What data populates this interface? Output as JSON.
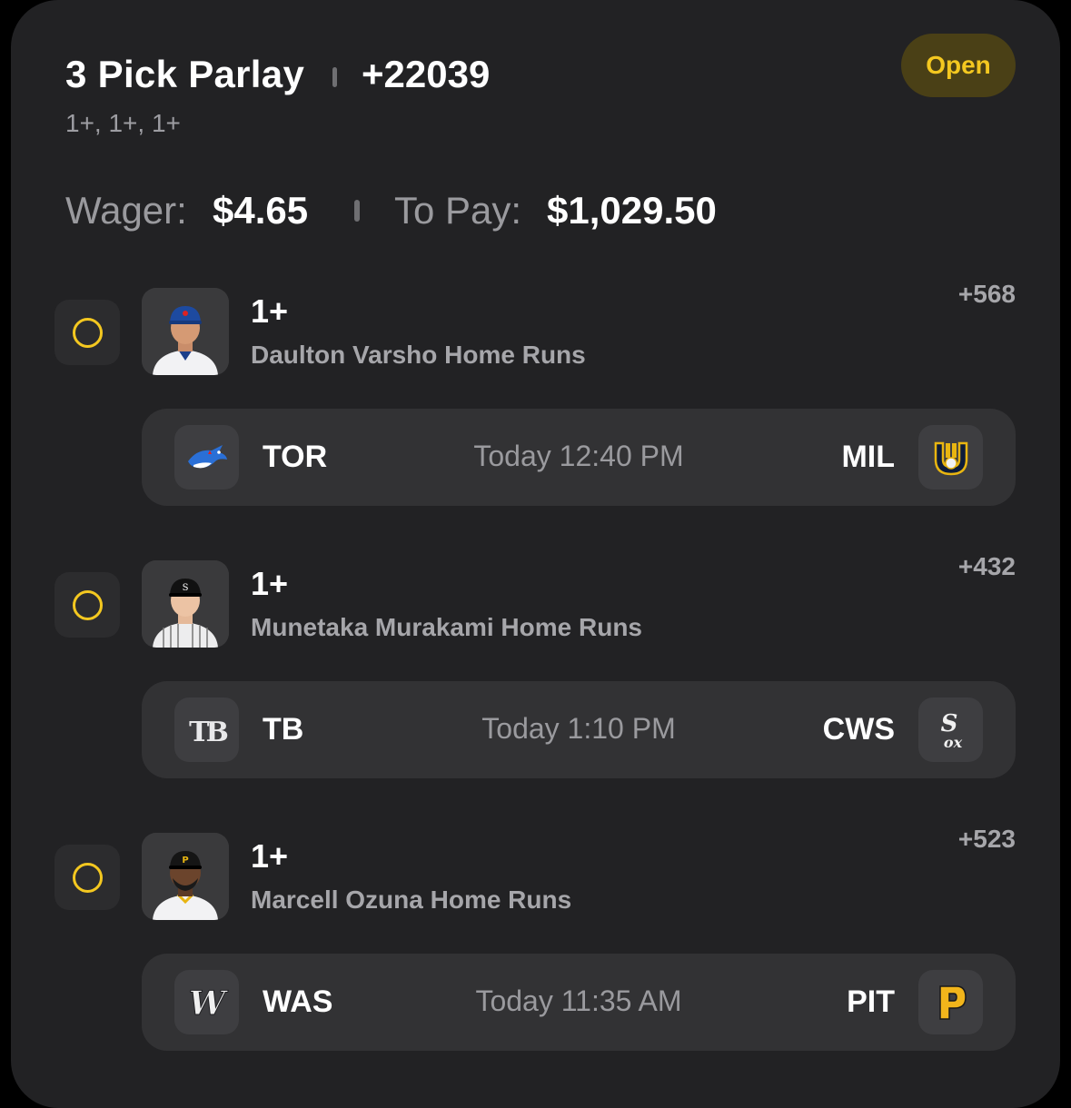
{
  "header": {
    "title": "3 Pick Parlay",
    "odds": "+22039",
    "subtitle": "1+, 1+, 1+",
    "status": "Open"
  },
  "wager": {
    "wager_label": "Wager:",
    "wager_value": "$4.65",
    "to_pay_label": "To Pay:",
    "to_pay_value": "$1,029.50"
  },
  "colors": {
    "accent": "#f4c820",
    "badge_bg": "#4a4016",
    "card_bg": "#222224",
    "row_bg": "#323234"
  },
  "picks": [
    {
      "line": "1+",
      "market": "Daulton Varsho Home Runs",
      "odds": "+568",
      "player_icon": "player-headshot-blue-jays",
      "away_abbr": "TOR",
      "away_icon": "blue-jays-logo-icon",
      "time": "Today 12:40 PM",
      "home_abbr": "MIL",
      "home_icon": "brewers-logo-icon"
    },
    {
      "line": "1+",
      "market": "Munetaka Murakami Home Runs",
      "odds": "+432",
      "player_icon": "player-headshot-white-sox",
      "away_abbr": "TB",
      "away_icon": "rays-logo-icon",
      "time": "Today 1:10 PM",
      "home_abbr": "CWS",
      "home_icon": "white-sox-logo-icon"
    },
    {
      "line": "1+",
      "market": "Marcell Ozuna Home Runs",
      "odds": "+523",
      "player_icon": "player-headshot-pirates",
      "away_abbr": "WAS",
      "away_icon": "nationals-logo-icon",
      "time": "Today 11:35 AM",
      "home_abbr": "PIT",
      "home_icon": "pirates-logo-icon"
    }
  ]
}
